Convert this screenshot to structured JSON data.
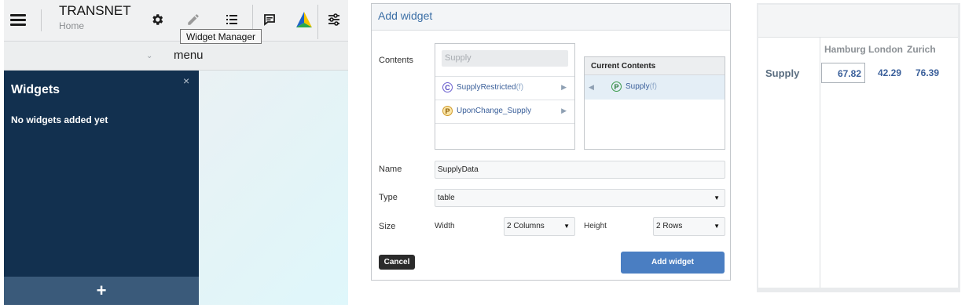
{
  "app": {
    "title": "TRANSNET",
    "subtitle": "Home",
    "tooltip": "Widget Manager",
    "menu_label": "menu",
    "toolbar_icons": [
      "menu-icon",
      "gear-icon",
      "pencil-icon",
      "list-icon",
      "comment-icon",
      "logo-icon",
      "sliders-icon"
    ],
    "sidebar": {
      "title": "Widgets",
      "empty_text": "No widgets added yet",
      "close_glyph": "×",
      "add_glyph": "+"
    },
    "colors": {
      "sidebar": "#12304f",
      "sidebar_footer": "#3a5a7a"
    }
  },
  "dialog": {
    "title": "Add widget",
    "contents_label": "Contents",
    "search_placeholder": "Supply",
    "available": [
      {
        "badge": "C",
        "name": "SupplyRestricted",
        "suffix": "(f)"
      },
      {
        "badge": "P",
        "name": "UponChange_Supply",
        "suffix": ""
      }
    ],
    "current_header": "Current Contents",
    "current": [
      {
        "badge": "P",
        "name": "Supply",
        "suffix": "(f)"
      }
    ],
    "name_label": "Name",
    "name_value": "SupplyData",
    "type_label": "Type",
    "type_value": "table",
    "size_label": "Size",
    "width_label": "Width",
    "width_value": "2 Columns",
    "height_label": "Height",
    "height_value": "2 Rows",
    "cancel_label": "Cancel",
    "add_label": "Add widget",
    "colors": {
      "accent": "#4a7ec2",
      "title": "#3a6ea5"
    }
  },
  "widget": {
    "columns": [
      "Hamburg",
      "London",
      "Zurich"
    ],
    "rows": [
      {
        "label": "Supply",
        "values": [
          "67.82",
          "42.29",
          "76.39"
        ]
      }
    ]
  }
}
